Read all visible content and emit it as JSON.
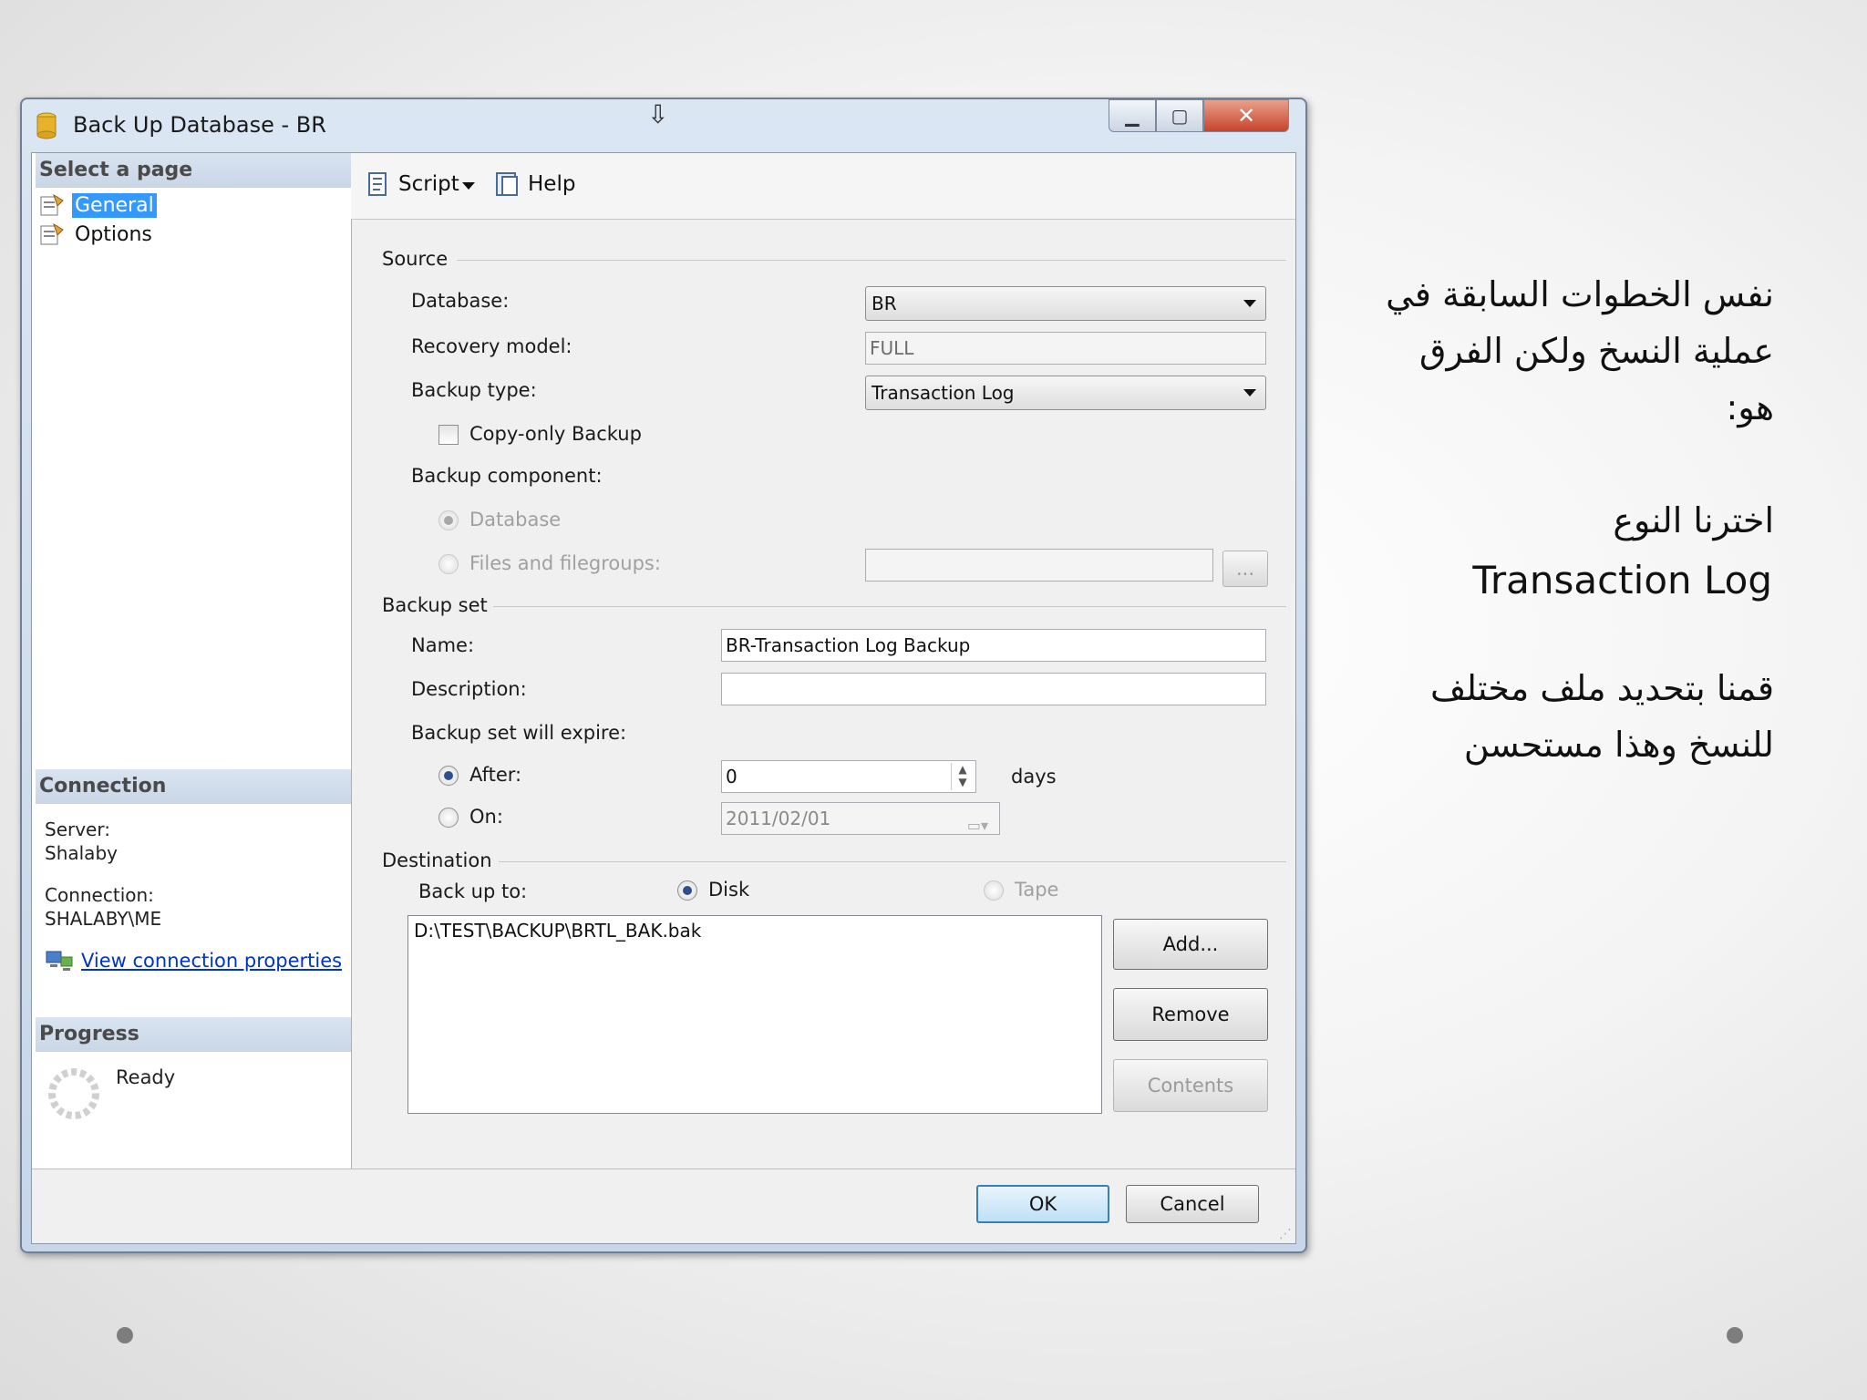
{
  "window": {
    "title": "Back Up Database - BR",
    "close_glyph": "✕",
    "min_glyph": "▁",
    "max_glyph": "▢"
  },
  "left_pane": {
    "select_page_header": "Select a page",
    "pages": [
      {
        "label": "General",
        "selected": true
      },
      {
        "label": "Options",
        "selected": false
      }
    ],
    "connection_header": "Connection",
    "server_label": "Server:",
    "server_value": "Shalaby",
    "connection_label": "Connection:",
    "connection_value": "SHALABY\\ME",
    "view_link": "View connection properties",
    "progress_header": "Progress",
    "progress_status": "Ready"
  },
  "toolbar": {
    "script_label": "Script",
    "help_label": "Help"
  },
  "source": {
    "group_label": "Source",
    "database_label": "Database:",
    "database_value": "BR",
    "recovery_label": "Recovery model:",
    "recovery_value": "FULL",
    "backup_type_label": "Backup type:",
    "backup_type_value": "Transaction Log",
    "copy_only_label": "Copy-only Backup",
    "component_label": "Backup component:",
    "component_database": "Database",
    "component_files": "Files and filegroups:",
    "browse_label": "..."
  },
  "backup_set": {
    "group_label": "Backup set",
    "name_label": "Name:",
    "name_value": "BR-Transaction Log  Backup",
    "description_label": "Description:",
    "description_value": "",
    "expire_label": "Backup set will expire:",
    "after_label": "After:",
    "after_value": "0",
    "days_label": "days",
    "on_label": "On:",
    "on_value": "2011/02/01"
  },
  "destination": {
    "group_label": "Destination",
    "backup_to_label": "Back up to:",
    "disk_label": "Disk",
    "tape_label": "Tape",
    "files": [
      "D:\\TEST\\BACKUP\\BRTL_BAK.bak"
    ],
    "add_label": "Add...",
    "remove_label": "Remove",
    "contents_label": "Contents"
  },
  "footer": {
    "ok_label": "OK",
    "cancel_label": "Cancel"
  },
  "slide_text": {
    "para1_line1": "نفس الخطوات السابقة في",
    "para1_line2": "عملية النسخ ولكن الفرق",
    "para1_line3": "هو:",
    "para2_line1": "اخترنا النوع",
    "para2_line2": "Transaction Log",
    "para3_line1": "قمنا بتحديد ملف مختلف",
    "para3_line2": "للنسخ وهذا مستحسن"
  }
}
